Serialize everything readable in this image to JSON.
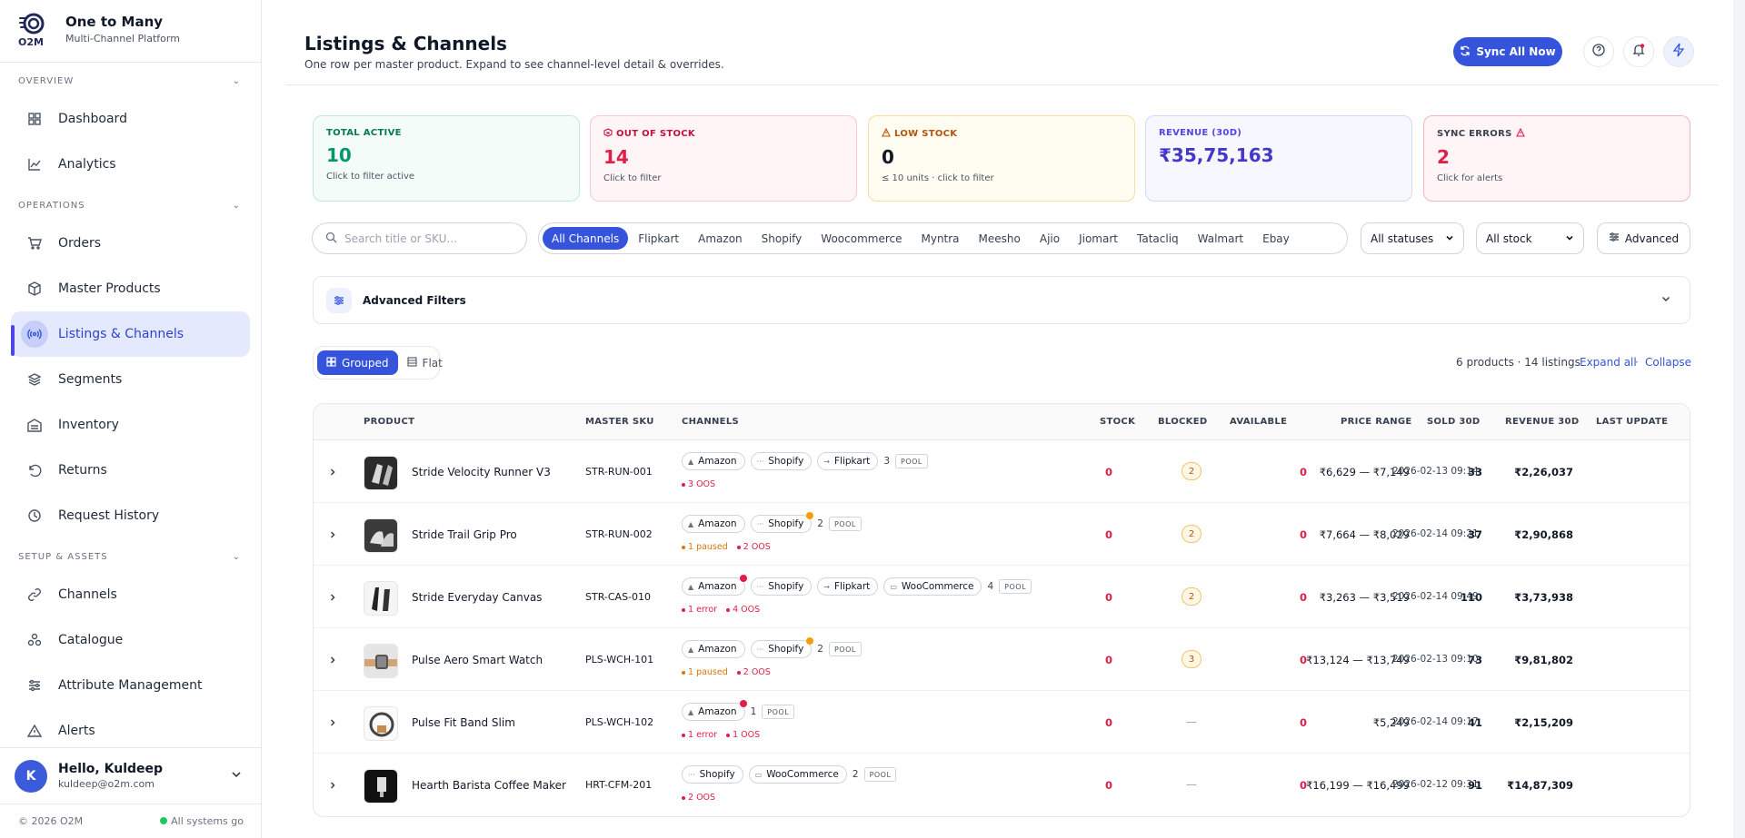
{
  "brand": {
    "logo_text": "O2M",
    "name": "One to Many",
    "subtitle": "Multi-Channel Platform"
  },
  "sidebar": {
    "sections": [
      {
        "label": "OVERVIEW"
      },
      {
        "label": "OPERATIONS"
      },
      {
        "label": "SETUP & ASSETS"
      }
    ],
    "items": [
      {
        "label": "Dashboard",
        "icon": "grid-icon"
      },
      {
        "label": "Analytics",
        "icon": "chart-line-icon"
      },
      {
        "label": "Orders",
        "icon": "cart-icon"
      },
      {
        "label": "Master Products",
        "icon": "box-icon"
      },
      {
        "label": "Listings & Channels",
        "icon": "broadcast-icon",
        "active": true
      },
      {
        "label": "Segments",
        "icon": "layers-icon"
      },
      {
        "label": "Inventory",
        "icon": "warehouse-icon"
      },
      {
        "label": "Returns",
        "icon": "undo-icon"
      },
      {
        "label": "Request History",
        "icon": "history-icon"
      },
      {
        "label": "Channels",
        "icon": "link-icon"
      },
      {
        "label": "Catalogue",
        "icon": "shapes-icon"
      },
      {
        "label": "Attribute Management",
        "icon": "sliders-icon"
      },
      {
        "label": "Alerts",
        "icon": "alert-triangle-icon"
      }
    ],
    "user": {
      "initial": "K",
      "greeting": "Hello, Kuldeep",
      "email": "kuldeep@o2m.com"
    },
    "footer": {
      "copyright": "© 2026 O2M",
      "status": "All systems go"
    }
  },
  "header": {
    "title": "Listings & Channels",
    "subtitle": "One row per master product. Expand to see channel-level detail & overrides.",
    "sync_label": "Sync All Now"
  },
  "cards": [
    {
      "title": "TOTAL ACTIVE",
      "value": "10",
      "sub": "Click to filter active"
    },
    {
      "title": "OUT OF STOCK",
      "value": "14",
      "sub": "Click to filter"
    },
    {
      "title": "LOW STOCK",
      "value": "0",
      "sub": "≤ 10 units · click to filter"
    },
    {
      "title": "REVENUE (30D)",
      "value": "₹35,75,163",
      "sub": ""
    },
    {
      "title": "SYNC ERRORS",
      "value": "2",
      "sub": "Click for alerts"
    }
  ],
  "filters": {
    "search_placeholder": "Search title or SKU…",
    "channels": [
      "All Channels",
      "Flipkart",
      "Amazon",
      "Shopify",
      "Woocommerce",
      "Myntra",
      "Meesho",
      "Ajio",
      "Jiomart",
      "Tatacliq",
      "Walmart",
      "Ebay"
    ],
    "status_select": "All statuses",
    "stock_select": "All stock",
    "advanced_label": "Advanced",
    "advanced_filters_label": "Advanced Filters"
  },
  "view": {
    "grouped_label": "Grouped",
    "flat_label": "Flat",
    "count_text": "6 products · 14 listings",
    "expand_label": "Expand all",
    "separator": "·",
    "collapse_label": "Collapse"
  },
  "table": {
    "headers": [
      "PRODUCT",
      "MASTER SKU",
      "CHANNELS",
      "STOCK",
      "BLOCKED",
      "AVAILABLE",
      "PRICE RANGE",
      "SOLD 30D",
      "REVENUE 30D",
      "LAST UPDATE"
    ],
    "rows": [
      {
        "name": "Stride Velocity Runner V3",
        "sku": "STR-RUN-001",
        "chips": [
          "Amazon",
          "Shopify",
          "Flipkart"
        ],
        "more": "3",
        "pool": "POOL",
        "status": [
          "3 OOS"
        ],
        "stock": "0",
        "blocked": "2",
        "available": "0",
        "price": "₹6,629 — ₹7,149",
        "sold": "33",
        "revenue": "₹2,26,037",
        "updated": "2026-02-13 09:14"
      },
      {
        "name": "Stride Trail Grip Pro",
        "sku": "STR-RUN-002",
        "chips": [
          "Amazon",
          "Shopify"
        ],
        "more": "2",
        "pool": "POOL",
        "status": [
          "1 paused",
          "2 OOS"
        ],
        "stock": "0",
        "blocked": "2",
        "available": "0",
        "price": "₹7,664 — ₹8,029",
        "sold": "37",
        "revenue": "₹2,90,868",
        "updated": "2026-02-14 09:21"
      },
      {
        "name": "Stride Everyday Canvas",
        "sku": "STR-CAS-010",
        "chips": [
          "Amazon",
          "Shopify",
          "Flipkart",
          "WooCommerce"
        ],
        "more": "4",
        "pool": "POOL",
        "status": [
          "1 error",
          "4 OOS"
        ],
        "stock": "0",
        "blocked": "2",
        "available": "0",
        "price": "₹3,263 — ₹3,519",
        "sold": "110",
        "revenue": "₹3,73,938",
        "updated": "2026-02-14 09:49"
      },
      {
        "name": "Pulse Aero Smart Watch",
        "sku": "PLS-WCH-101",
        "chips": [
          "Amazon",
          "Shopify"
        ],
        "more": "2",
        "pool": "POOL",
        "status": [
          "1 paused",
          "2 OOS"
        ],
        "stock": "0",
        "blocked": "3",
        "available": "0",
        "price": "₹13,124 — ₹13,749",
        "sold": "73",
        "revenue": "₹9,81,802",
        "updated": "2026-02-13 09:10"
      },
      {
        "name": "Pulse Fit Band Slim",
        "sku": "PLS-WCH-102",
        "chips": [
          "Amazon"
        ],
        "more": "1",
        "pool": "POOL",
        "status": [
          "1 error",
          "1 OOS"
        ],
        "stock": "0",
        "blocked": "—",
        "available": "0",
        "price": "₹5,249",
        "sold": "41",
        "revenue": "₹2,15,209",
        "updated": "2026-02-14 09:17"
      },
      {
        "name": "Hearth Barista Coffee Maker",
        "sku": "HRT-CFM-201",
        "chips": [
          "Shopify",
          "WooCommerce"
        ],
        "more": "2",
        "pool": "POOL",
        "status": [
          "2 OOS"
        ],
        "stock": "0",
        "blocked": "—",
        "available": "0",
        "price": "₹16,199 — ₹16,499",
        "sold": "91",
        "revenue": "₹14,87,309",
        "updated": "2026-02-12 09:31"
      }
    ]
  },
  "colors": {
    "accent": "#3554db",
    "danger": "#e11d48",
    "warning": "#d97706",
    "success": "#059669"
  }
}
